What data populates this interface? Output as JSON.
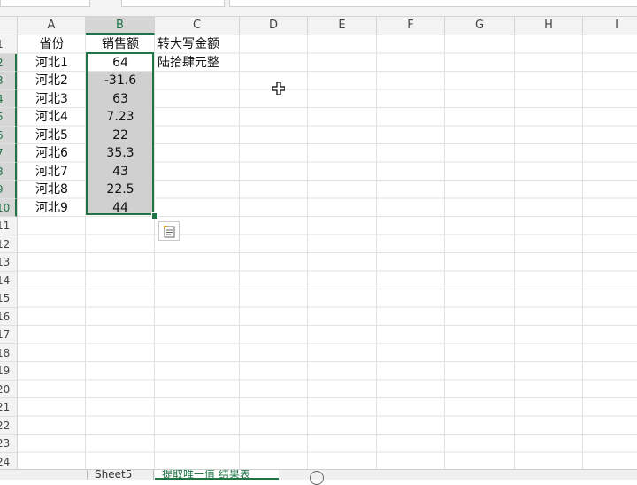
{
  "columns": [
    "A",
    "B",
    "C",
    "D",
    "E",
    "F",
    "G",
    "H",
    "I"
  ],
  "selected_column": "B",
  "rows": [
    "1",
    "2",
    "3",
    "4",
    "5",
    "6",
    "7",
    "8",
    "9",
    "10",
    "11",
    "12",
    "13",
    "14",
    "15",
    "16",
    "17",
    "18",
    "19",
    "20",
    "21",
    "22",
    "23",
    "24"
  ],
  "cells": {
    "A1": "省份",
    "B1": "销售额",
    "C1": "转大写金额",
    "A2": "河北1",
    "B2": "64",
    "C2": "陆拾肆元整",
    "A3": "河北2",
    "B3": "-31.6",
    "A4": "河北3",
    "B4": "63",
    "A5": "河北4",
    "B5": "7.23",
    "A6": "河北5",
    "B6": "22",
    "A7": "河北6",
    "B7": "35.3",
    "A8": "河北7",
    "B8": "43",
    "A9": "河北8",
    "B9": "22.5",
    "A10": "河北9",
    "B10": "44"
  },
  "sheet_tabs": [
    "Sheet5",
    "提取唯一值 结果表"
  ],
  "colors": {
    "accent": "#217346",
    "selection_fill": "#d0d0d0"
  }
}
